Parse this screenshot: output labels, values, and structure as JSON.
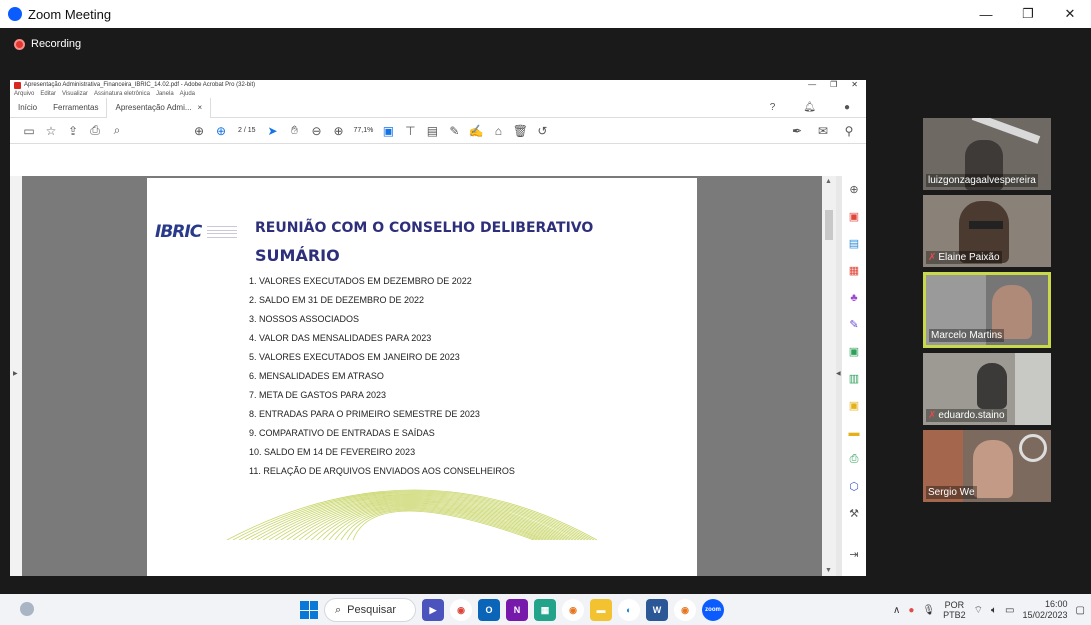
{
  "zoom": {
    "window_title": "Zoom Meeting",
    "recording_label": "Recording",
    "win_minimize": "—",
    "win_restore": "❐",
    "win_close": "✕"
  },
  "acrobat": {
    "window_title": "Apresentação Administrativa_Financeira_IBRIC_14.02.pdf - Adobe Acrobat Pro (32-bit)",
    "menu": [
      "Arquivo",
      "Editar",
      "Visualizar",
      "Assinatura eletrônica",
      "Janela",
      "Ajuda"
    ],
    "tab_home": "Início",
    "tab_tools": "Ferramentas",
    "tab_doc": "Apresentação Admi...",
    "tab_doc_close": "×",
    "page_indicator": "2 / 15",
    "zoom_level": "77,1%"
  },
  "document": {
    "logo": "IBRIC",
    "heading": "REUNIÃO COM O CONSELHO DELIBERATIVO",
    "subheading": "SUMÁRIO",
    "agenda": [
      "1.  VALORES EXECUTADOS EM DEZEMBRO DE 2022",
      "2.  SALDO EM 31 DE DEZEMBRO DE 2022",
      "3.  NOSSOS ASSOCIADOS",
      "4.  VALOR DAS MENSALIDADES PARA 2023",
      "5.  VALORES EXECUTADOS EM JANEIRO DE 2023",
      "6.  MENSALIDADES EM ATRASO",
      "7.  META DE GASTOS PARA 2023",
      "8.  ENTRADAS PARA O PRIMEIRO SEMESTRE DE 2023",
      "9.  COMPARATIVO DE ENTRADAS E SAÍDAS",
      "10. SALDO EM 14 DE FEVEREIRO 2023",
      "11. RELAÇÃO DE ARQUIVOS ENVIADOS AOS CONSELHEIROS"
    ]
  },
  "participants": [
    {
      "name": "luizgonzagaalvespereira",
      "muted": false,
      "bg": "#6e6a63"
    },
    {
      "name": "Elaine Paixão",
      "muted": true,
      "bg": "#7d766c"
    },
    {
      "name": "Marcelo Martins",
      "muted": false,
      "bg": "#767676"
    },
    {
      "name": "eduardo.staino",
      "muted": true,
      "bg": "#8d8a82"
    },
    {
      "name": "Sergio We",
      "muted": false,
      "bg": "#6b5d55"
    }
  ],
  "taskbar": {
    "search_label": "Pesquisar",
    "lang_top": "POR",
    "lang_bottom": "PTB2",
    "time": "16:00",
    "date": "15/02/2023"
  },
  "colors": {
    "zoom_blue": "#0b5cff",
    "heading_navy": "#2e2f7a",
    "active_speaker": "#c8d94a",
    "recording_red": "#e5362f"
  }
}
